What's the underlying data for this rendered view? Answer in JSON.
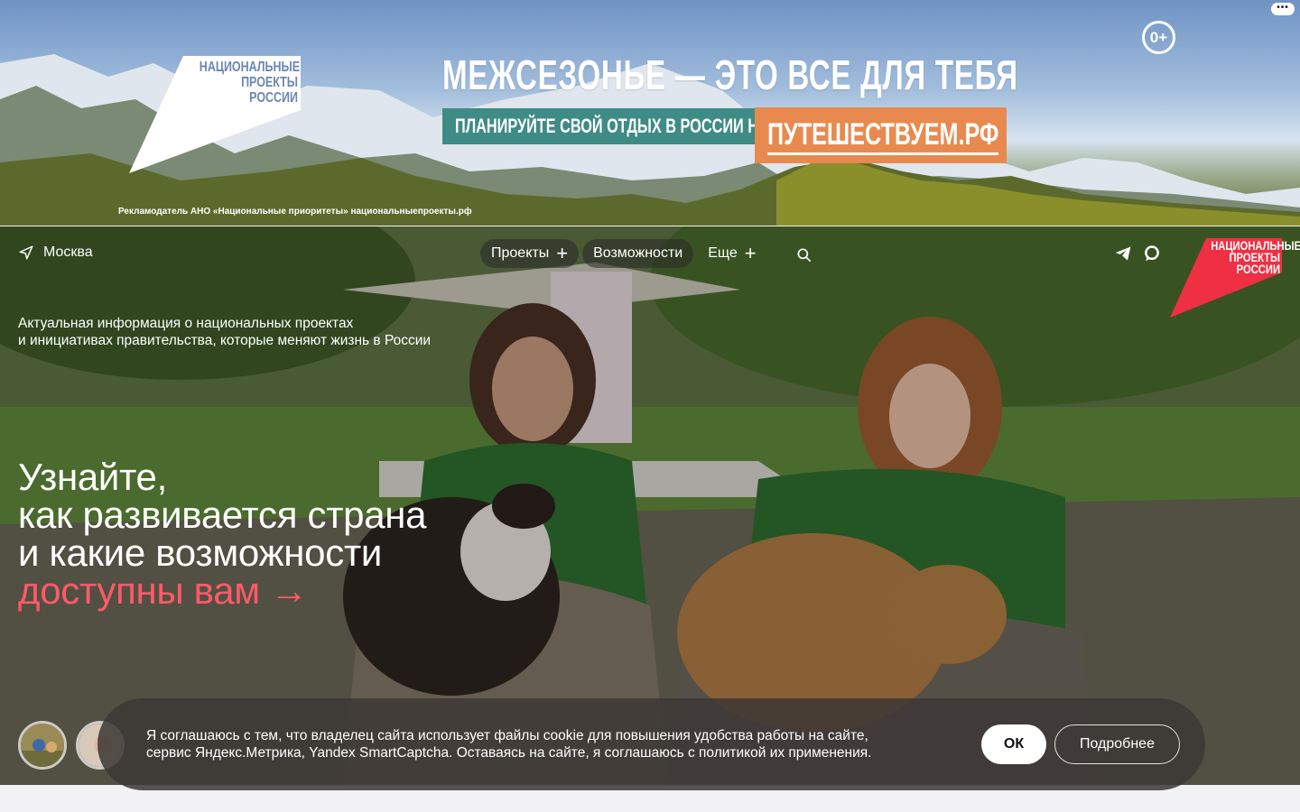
{
  "ad": {
    "more_label": "•••",
    "age_rating": "0+",
    "logo_text": "НАЦИОНАЛЬНЫЕ ПРОЕКТЫ РОССИИ",
    "headline": "МЕЖСЕЗОНЬЕ — ЭТО ВСЕ ДЛЯ ТЕБЯ",
    "plan_text": "ПЛАНИРУЙТЕ СВОЙ ОТДЫХ В РОССИИ НА",
    "site": "ПУТЕШЕСТВУЕМ.РФ",
    "disclaimer": "Рекламодатель АНО «Национальные приоритеты»    национальныепроекты.рф"
  },
  "header": {
    "location": "Москва",
    "nav": [
      {
        "label": "Проекты",
        "has_plus": true
      },
      {
        "label": "Возможности",
        "has_plus": false
      },
      {
        "label": "Еще",
        "has_plus": true
      }
    ],
    "logo_text": "НАЦИОНАЛЬНЫЕ ПРОЕКТЫ РОССИИ"
  },
  "hero": {
    "subtitle_line1": "Актуальная информация о национальных проектах",
    "subtitle_line2": "и инициативах правительства, которые меняют жизнь в России",
    "headline_line1": "Узнайте,",
    "headline_line2": "как развивается страна",
    "headline_line3": "и какие возможности",
    "headline_accent": "доступны вам →"
  },
  "cookie": {
    "text_line1": "Я соглашаюсь с тем, что владелец сайта использует файлы cookie для повышения удобства работы на сайте,",
    "text_line2": "сервис Яндекс.Метрика, Yandex SmartCaptcha. Оставаясь на сайте, я соглашаюсь с политикой их применения.",
    "ok_label": "ОК",
    "more_label": "Подробнее"
  },
  "colors": {
    "accent": "#ff5a68",
    "ad_teal": "#3f8b86",
    "ad_orange": "#e88a4f",
    "logo_red": "#ef3044"
  }
}
